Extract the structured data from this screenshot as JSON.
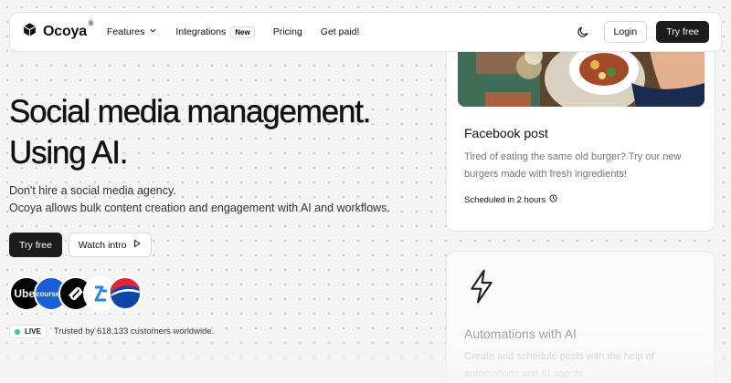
{
  "nav": {
    "brand": "Ocoya",
    "brand_mark": "®",
    "links": [
      {
        "label": "Features"
      },
      {
        "label": "Integrations",
        "badge": "New"
      },
      {
        "label": "Pricing"
      },
      {
        "label": "Get paid!"
      }
    ],
    "login_label": "Login",
    "try_label": "Try free",
    "theme_icon": "moon-icon"
  },
  "hero": {
    "title_line1": "Social media management.",
    "title_line2": "Using AI.",
    "desc_line1": "Don't hire a social media agency.",
    "desc_line2": "Ocoya allows bulk content creation and engagement with AI and workflows.",
    "try_label": "Try free",
    "watch_label": "Watch intro",
    "avatars": [
      {
        "name": "Uber",
        "text": "Uber"
      },
      {
        "name": "coursera",
        "text": "coursera"
      },
      {
        "name": "Squarespace",
        "text": ""
      },
      {
        "name": "Bitrix",
        "text": ""
      },
      {
        "name": "Pepsi",
        "text": ""
      }
    ],
    "live_label": "LIVE",
    "trust_text": "Trusted by 618,133 customers worldwide."
  },
  "cards": {
    "facebook": {
      "title": "Facebook post",
      "text": "Tired of eating the same old burger? Try our new burgers made with fresh ingredients!",
      "scheduled": "Scheduled in 2 hours"
    },
    "automation": {
      "title": "Automations with AI",
      "text": "Create and schedule posts with the help of automations and AI agents."
    }
  },
  "colors": {
    "dark_button": "#1d1d1d",
    "live_dot": "#2ecc71",
    "page_bg": "#f5f5f5"
  }
}
